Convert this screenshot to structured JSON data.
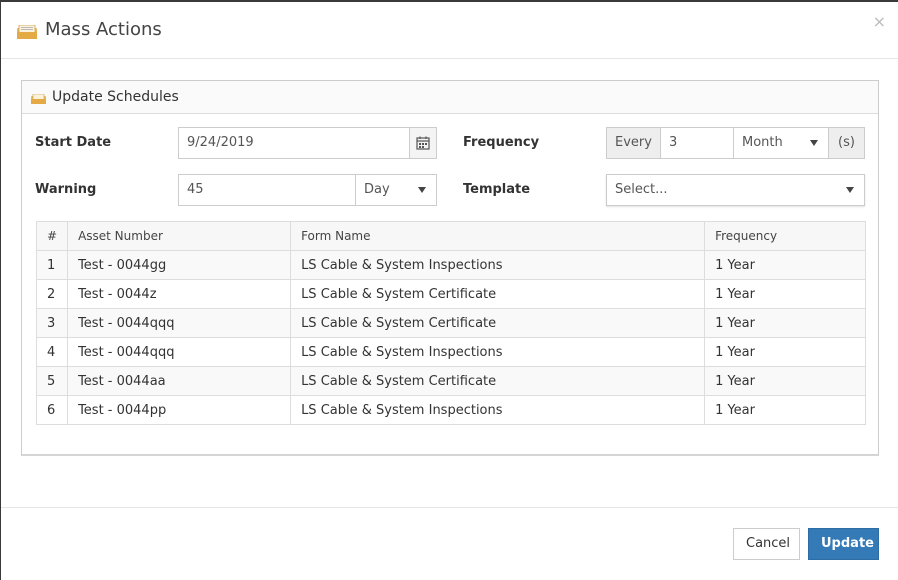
{
  "modal": {
    "title": "Mass Actions",
    "close": "×"
  },
  "panel": {
    "title": "Update Schedules"
  },
  "form": {
    "start_date_label": "Start Date",
    "start_date_value": "9/24/2019",
    "warning_label": "Warning",
    "warning_value": "45",
    "warning_unit": "Day",
    "frequency_label": "Frequency",
    "frequency_prefix": "Every",
    "frequency_value": "3",
    "frequency_unit": "Month",
    "frequency_suffix": "(s)",
    "template_label": "Template",
    "template_value": "Select..."
  },
  "table": {
    "headers": [
      "#",
      "Asset Number",
      "Form Name",
      "Frequency"
    ],
    "rows": [
      [
        "1",
        "Test - 0044gg",
        "LS Cable & System Inspections",
        "1 Year"
      ],
      [
        "2",
        "Test - 0044z",
        "LS Cable & System Certificate",
        "1 Year"
      ],
      [
        "3",
        "Test - 0044qqq",
        "LS Cable & System Certificate",
        "1 Year"
      ],
      [
        "4",
        "Test - 0044qqq",
        "LS Cable & System Inspections",
        "1 Year"
      ],
      [
        "5",
        "Test - 0044aa",
        "LS Cable & System Certificate",
        "1 Year"
      ],
      [
        "6",
        "Test - 0044pp",
        "LS Cable & System Inspections",
        "1 Year"
      ]
    ]
  },
  "footer": {
    "cancel_label": "Cancel",
    "update_label": "Update"
  },
  "colors": {
    "primary": "#337ab7",
    "icon": "#f0c36d"
  }
}
